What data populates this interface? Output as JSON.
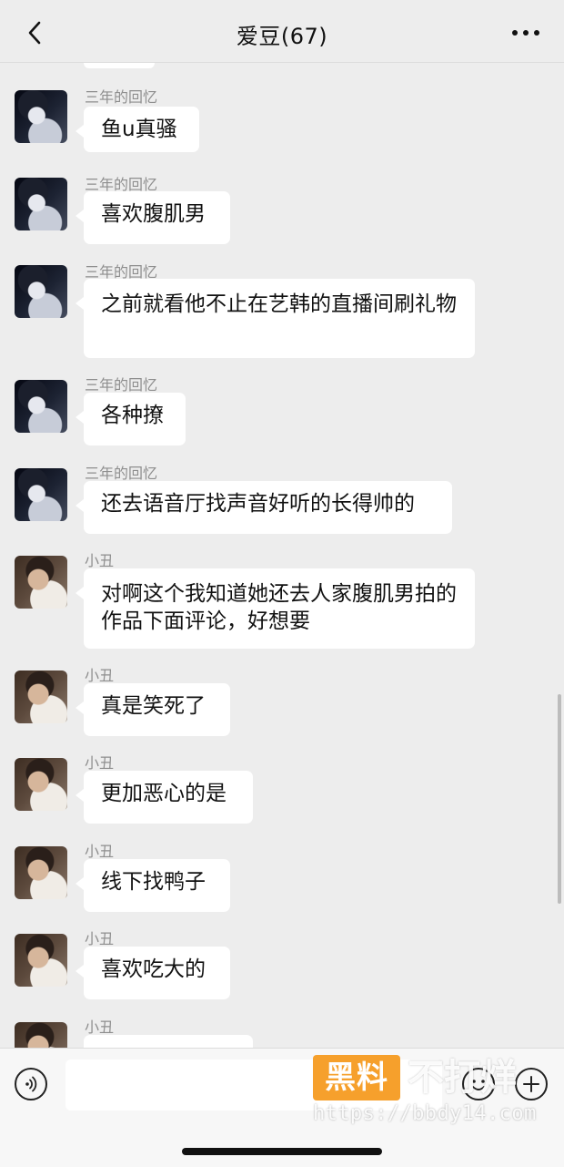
{
  "header": {
    "title": "爱豆(67)"
  },
  "icons": {
    "back": "chevron-left-icon",
    "more": "more-dots-icon",
    "voice": "voice-icon",
    "emoji": "emoji-icon",
    "plus": "plus-icon"
  },
  "messages": [
    {
      "sender": "三年的回忆",
      "text": "鱼u真骚"
    },
    {
      "sender": "三年的回忆",
      "text": "喜欢腹肌男"
    },
    {
      "sender": "三年的回忆",
      "text": "之前就看他不止在艺韩的直播间刷礼物"
    },
    {
      "sender": "三年的回忆",
      "text": "各种撩"
    },
    {
      "sender": "三年的回忆",
      "text": "还去语音厅找声音好听的长得帅的"
    },
    {
      "sender": "小丑",
      "text": "对啊这个我知道她还去人家腹肌男拍的作品下面评论，好想要"
    },
    {
      "sender": "小丑",
      "text": "真是笑死了"
    },
    {
      "sender": "小丑",
      "text": "更加恶心的是"
    },
    {
      "sender": "小丑",
      "text": "线下找鸭子"
    },
    {
      "sender": "小丑",
      "text": "喜欢吃大的"
    },
    {
      "sender": "小丑",
      "text": ""
    }
  ],
  "watermark": {
    "badge": "黑料",
    "text": "不打烊",
    "url": "https://bbdy14.com"
  },
  "colors": {
    "background": "#ededed",
    "bubble": "#ffffff",
    "sender": "#8e8e8e",
    "watermark_badge": "#f6a02c"
  }
}
